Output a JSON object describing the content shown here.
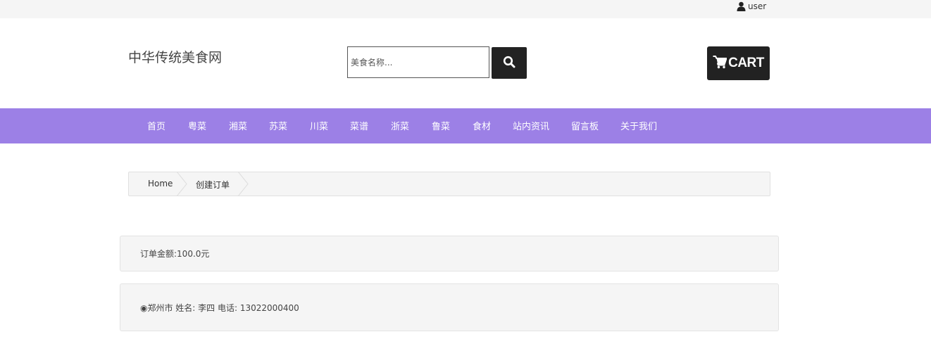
{
  "topbar": {
    "user_label": "user"
  },
  "header": {
    "brand": "中华传统美食网",
    "search": {
      "placeholder": "美食名称...",
      "value": ""
    },
    "cart_label": "CART"
  },
  "nav": {
    "items": [
      "首页",
      "粤菜",
      "湘菜",
      "苏菜",
      "川菜",
      "菜谱",
      "浙菜",
      "鲁菜",
      "食材",
      "站内资讯",
      "留言板",
      "关于我们"
    ]
  },
  "breadcrumb": {
    "home": "Home",
    "current": "创建订单"
  },
  "order": {
    "amount": "订单金额:100.0元",
    "address_option": "◉郑州市 姓名: 李四 电话: 13022000400"
  },
  "colors": {
    "nav_bg": "#9c80e6",
    "button_bg": "#222222",
    "panel_bg": "#f5f5f5"
  },
  "icons": {
    "user": "user-icon",
    "search": "search-icon",
    "cart": "cart-icon"
  }
}
